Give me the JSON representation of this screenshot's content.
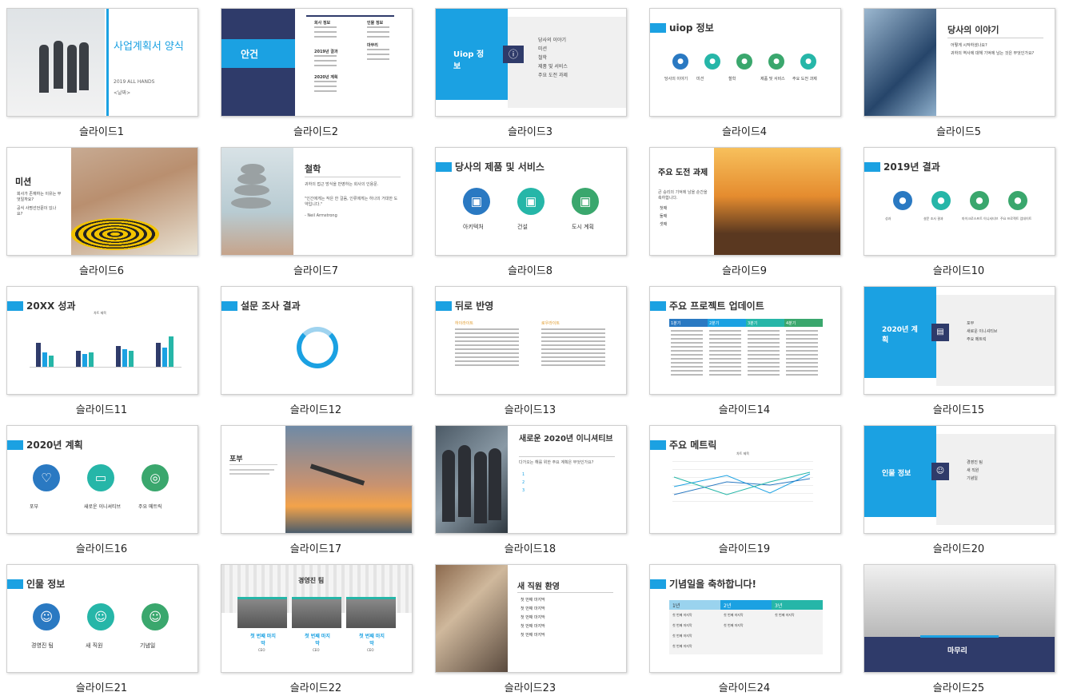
{
  "colors": {
    "accent": "#1ba1e2",
    "navy": "#2f3b6a",
    "teal": "#26b6a8",
    "green": "#3aa76d"
  },
  "slides": [
    {
      "caption": "슬라이드1",
      "title": "사업계획서 양식",
      "sub": "2019 ALL HANDS",
      "sub2": "<날짜>"
    },
    {
      "caption": "슬라이드2",
      "title": "안건",
      "items": [
        "회사 정보",
        "인물 정보",
        "2019년 결과",
        "2020년 계획",
        "마무리"
      ]
    },
    {
      "caption": "슬라이드3",
      "title": "Uiop 정보",
      "items": [
        "당사의 이야기",
        "미션",
        "철학",
        "제품 및 서비스",
        "주요 도전 과제"
      ]
    },
    {
      "caption": "슬라이드4",
      "title": "uiop 정보",
      "items": [
        "당사의 이야기",
        "미션",
        "철학",
        "제품 및 서비스",
        "주요 도전 과제"
      ]
    },
    {
      "caption": "슬라이드5",
      "title": "당사의 이야기",
      "items": [
        "어떻게 시작하셨나요?",
        "귀하의 역사에 대해 기억에 남는 것은 무엇인가요?"
      ]
    },
    {
      "caption": "슬라이드6",
      "title": "미션",
      "items": [
        "회사가 존재하는 이유는 무엇일까요?",
        "공식 사명선언문이 있나요?"
      ]
    },
    {
      "caption": "슬라이드7",
      "title": "철학",
      "body": "귀하의 접근 방식을 반영하는 회사의 인용문.",
      "quote": "\"인간에게는 작은 한 걸음, 인류에게는 하나의 거대한 도약입니다.\"",
      "author": "- Neil Armstrong"
    },
    {
      "caption": "슬라이드8",
      "title": "당사의 제품 및 서비스",
      "items": [
        "아키텍처",
        "건설",
        "도시 계획"
      ]
    },
    {
      "caption": "슬라이드9",
      "title": "주요 도전 과제",
      "body": "큰 승리의 기억에 남을 순간을 축하합니다.",
      "items": [
        "첫째",
        "둘째",
        "셋째"
      ]
    },
    {
      "caption": "슬라이드10",
      "title": "2019년 결과",
      "items": [
        "성과",
        "설문 조사 결과",
        "마이크로스프트 이니셔티브",
        "주요 프로젝트 업데이트"
      ]
    },
    {
      "caption": "슬라이드11",
      "title": "20XX 성과",
      "chart_title": "차트 제목"
    },
    {
      "caption": "슬라이드12",
      "title": "설문 조사 결과"
    },
    {
      "caption": "슬라이드13",
      "title": "뒤로 반영",
      "col1": "하이라이트",
      "col2": "로우라이트"
    },
    {
      "caption": "슬라이드14",
      "title": "주요 프로젝트 업데이트",
      "headers": [
        "1분기",
        "2분기",
        "3분기",
        "4분기"
      ]
    },
    {
      "caption": "슬라이드15",
      "title": "2020년 계획",
      "items": [
        "포부",
        "새로운 이니셔티브",
        "주요 메트릭"
      ]
    },
    {
      "caption": "슬라이드16",
      "title": "2020년 계획",
      "items": [
        "포부",
        "새로운 이니셔티브",
        "주요 메트릭"
      ]
    },
    {
      "caption": "슬라이드17",
      "title": "포부"
    },
    {
      "caption": "슬라이드18",
      "title": "새로운 2020년 이니셔티브",
      "body": "다가오는 해를 위한 주요 계획은 무엇인가요?",
      "items": [
        "1",
        "2",
        "3"
      ]
    },
    {
      "caption": "슬라이드19",
      "title": "주요 메트릭",
      "chart_title": "차트 제목"
    },
    {
      "caption": "슬라이드20",
      "title": "인물 정보",
      "items": [
        "경영진 팀",
        "새 직원",
        "기념일"
      ]
    },
    {
      "caption": "슬라이드21",
      "title": "인물 정보",
      "items": [
        "경영진 팀",
        "새 직원",
        "기념일"
      ]
    },
    {
      "caption": "슬라이드22",
      "title": "경영진 팀",
      "people": [
        {
          "name": "첫 번째 마지막",
          "role": "CEO"
        },
        {
          "name": "첫 번째 마지막",
          "role": "CEO"
        },
        {
          "name": "첫 번째 마지막",
          "role": "CEO"
        }
      ]
    },
    {
      "caption": "슬라이드23",
      "title": "새 직원 환영",
      "items": [
        "첫 번째 마지막",
        "첫 번째 마지막",
        "첫 번째 마지막",
        "첫 번째 마지막",
        "첫 번째 마지막"
      ]
    },
    {
      "caption": "슬라이드24",
      "title": "기념일을 축하합니다!",
      "headers": [
        "1년",
        "2년",
        "3년"
      ],
      "cell": "첫 번째 마지막"
    },
    {
      "caption": "슬라이드25",
      "title": "마무리"
    }
  ]
}
